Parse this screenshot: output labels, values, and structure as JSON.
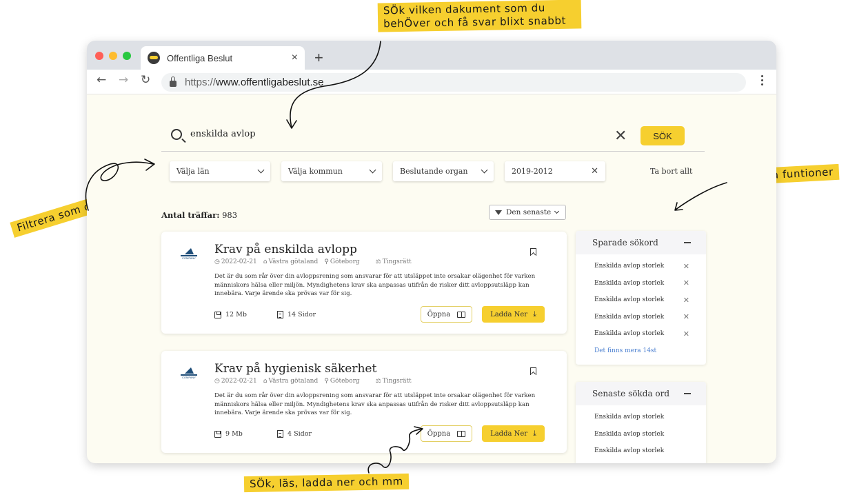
{
  "annotations": {
    "top_line1": "SÖk vilken dakument som du",
    "top_line2": "behÖver och få svar blixt snabbt",
    "left": "Filtrera som du vill",
    "right": "Smartta funtioner",
    "bottom": "SÖk, läs, ladda ner och mm"
  },
  "colors": {
    "accent": "#f6cf2f",
    "page_bg": "#fdfcf2",
    "link": "#4a7fd0"
  },
  "browser": {
    "tab_title": "Offentliga Beslut",
    "tab_close": "×",
    "new_tab": "+",
    "url_protocol": "https://",
    "url_host": "www.offentligabeslut.se",
    "icons": [
      "back-icon",
      "forward-icon",
      "reload-icon",
      "lock-icon",
      "menu-icon"
    ]
  },
  "search": {
    "value": "enskilda avlop",
    "button": "SÖK"
  },
  "filters": [
    {
      "label": "Välja län",
      "control": "chevron"
    },
    {
      "label": "Välja kommun",
      "control": "chevron"
    },
    {
      "label": "Beslutande organ",
      "control": "chevron"
    },
    {
      "label": "2019-2012",
      "control": "clear"
    }
  ],
  "clear_all": "Ta bort allt",
  "results": {
    "count_label": "Antal träffar:",
    "count": "983",
    "sort_label": "Den senaste",
    "items": [
      {
        "title": "Krav på enskilda avlopp",
        "logo_text": "COMPANY",
        "date": "2022-02-21",
        "region": "Västra götaland",
        "city": "Göteborg",
        "court": "Tingsrätt",
        "description": "Det är du som rår över din avloppsrening som ansvarar för att utsläppet inte orsakar olägenhet för varken människors hälsa eller miljön. Myndighetens krav ska anpassas utifrån de risker ditt avloppsutsläpp kan innebära. Varje ärende ska prövas var för sig.",
        "size": "12 Mb",
        "pages": "14 Sidor",
        "open_label": "Öppna",
        "download_label": "Ladda Ner"
      },
      {
        "title": "Krav på hygienisk säkerhet",
        "logo_text": "COMPANY",
        "date": "2022-02-21",
        "region": "Västra götaland",
        "city": "Göteborg",
        "court": "Tingsrätt",
        "description": "Det är du som rår över din avloppsrening som ansvarar för att utsläppet inte orsakar olägenhet för varken människors hälsa eller miljön. Myndighetens krav ska anpassas utifrån de risker ditt avloppsutsläpp kan innebära. Varje ärende ska prövas var för sig.",
        "size": "9 Mb",
        "pages": "4 Sidor",
        "open_label": "Öppna",
        "download_label": "Ladda Ner"
      }
    ]
  },
  "saved_searches": {
    "title": "Sparade sökord",
    "items": [
      "Enskilda avlop storlek",
      "Enskilda avlop storlek",
      "Enskilda avlop storlek",
      "Enskilda avlop storlek",
      "Enskilda avlop storlek"
    ],
    "more": "Det finns mera 14st"
  },
  "recent_searches": {
    "title": "Senaste sökda ord",
    "items": [
      "Enskilda avlop storlek",
      "Enskilda avlop storlek",
      "Enskilda avlop storlek"
    ]
  }
}
